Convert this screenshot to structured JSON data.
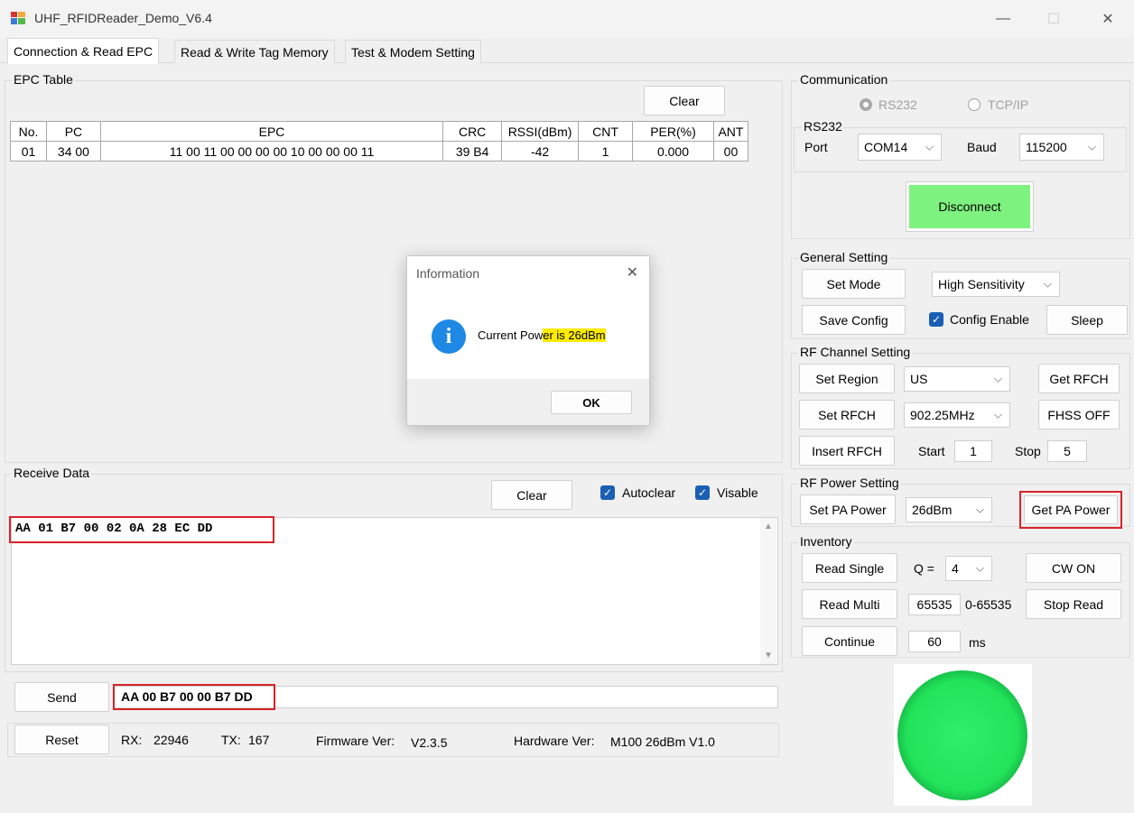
{
  "window": {
    "title": "UHF_RFIDReader_Demo_V6.4",
    "minimize": "—",
    "maximize": "☐",
    "close": "✕"
  },
  "tabs": [
    {
      "label": "Connection & Read EPC",
      "active": true
    },
    {
      "label": "Read & Write Tag Memory",
      "active": false
    },
    {
      "label": "Test & Modem Setting",
      "active": false
    }
  ],
  "epc_table": {
    "group_label": "EPC Table",
    "clear_label": "Clear",
    "columns": [
      "No.",
      "PC",
      "EPC",
      "CRC",
      "RSSI(dBm)",
      "CNT",
      "PER(%)",
      "ANT"
    ],
    "rows": [
      [
        "01",
        "34 00",
        "11 00 11 00 00 00 00 10 00 00 00 11",
        "39 B4",
        "-42",
        "1",
        "0.000",
        "00"
      ]
    ]
  },
  "receive": {
    "group_label": "Receive Data",
    "clear_label": "Clear",
    "autoclear_label": "Autoclear",
    "visable_label": "Visable",
    "data": "AA 01 B7 00 02 0A 28 EC DD"
  },
  "send": {
    "send_label": "Send",
    "value": "AA 00 B7 00 00 B7 DD"
  },
  "status": {
    "reset_label": "Reset",
    "rx_label": "RX:",
    "rx_value": "22946",
    "tx_label": "TX:",
    "tx_value": "167",
    "fw_label": "Firmware Ver:",
    "fw_value": "V2.3.5",
    "hw_label": "Hardware Ver:",
    "hw_value": "M100 26dBm V1.0"
  },
  "communication": {
    "group_label": "Communication",
    "rs232_radio": "RS232",
    "tcpip_radio": "TCP/IP",
    "rs232_group": "RS232",
    "port_label": "Port",
    "port_value": "COM14",
    "baud_label": "Baud",
    "baud_value": "115200",
    "disconnect_label": "Disconnect"
  },
  "general": {
    "group_label": "General Setting",
    "set_mode": "Set Mode",
    "mode_value": "High Sensitivity",
    "save_config": "Save Config",
    "config_enable": "Config Enable",
    "sleep": "Sleep"
  },
  "rf_channel": {
    "group_label": "RF Channel Setting",
    "set_region": "Set Region",
    "region_value": "US",
    "get_rfch": "Get RFCH",
    "set_rfch": "Set RFCH",
    "freq_value": "902.25MHz",
    "fhss_off": "FHSS OFF",
    "insert_rfch": "Insert RFCH",
    "start_label": "Start",
    "start_value": "1",
    "stop_label": "Stop",
    "stop_value": "5"
  },
  "rf_power": {
    "group_label": "RF Power Setting",
    "set_pa_power": "Set PA Power",
    "power_value": "26dBm",
    "get_pa_power": "Get PA Power"
  },
  "inventory": {
    "group_label": "Inventory",
    "read_single": "Read Single",
    "q_label": "Q =",
    "q_value": "4",
    "cw_on": "CW ON",
    "read_multi": "Read Multi",
    "multi_value": "65535",
    "multi_range": "0-65535",
    "stop_read": "Stop Read",
    "continue": "Continue",
    "interval_value": "60",
    "interval_unit": "ms"
  },
  "indicator": {
    "color": "#22e35a"
  },
  "dialog": {
    "title": "Information",
    "message_prefix": "Current Pow",
    "message_highlight": "er is 26dBm",
    "ok_label": "OK"
  },
  "colors": {
    "disconnect_bg": "#7ef27e",
    "highlight_box": "#d8232a",
    "text_highlight": "#ffeb00",
    "info_icon": "#1e88e5"
  }
}
